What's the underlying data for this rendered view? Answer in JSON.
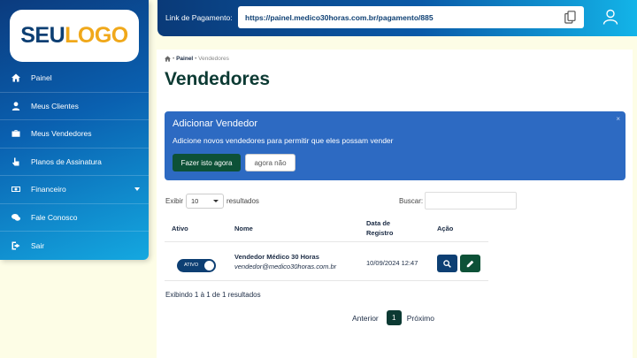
{
  "logo": {
    "part1": "SEU",
    "part2": "LOGO"
  },
  "topbar": {
    "payment_label": "Link de Pagamento:",
    "payment_url": "https://painel.medico30horas.com.br/pagamento/885"
  },
  "sidebar": {
    "items": [
      {
        "label": "Painel",
        "icon": "home-icon"
      },
      {
        "label": "Meus Clientes",
        "icon": "user-icon"
      },
      {
        "label": "Meus Vendedores",
        "icon": "briefcase-icon"
      },
      {
        "label": "Planos de Assinatura",
        "icon": "hand-pointer-icon"
      },
      {
        "label": "Financeiro",
        "icon": "money-icon"
      },
      {
        "label": "Fale Conosco",
        "icon": "chat-icon"
      },
      {
        "label": "Sair",
        "icon": "sign-out-icon"
      }
    ]
  },
  "breadcrumb": {
    "home": "Painel",
    "current": "Vendedores",
    "separator": "•"
  },
  "page": {
    "title": "Vendedores"
  },
  "alert": {
    "title": "Adicionar Vendedor",
    "close": "×",
    "text": "Adicione novos vendedores para permitir que eles possam vender",
    "primary_button": "Fazer isto agora",
    "secondary_button": "agora não"
  },
  "table_controls": {
    "show_label": "Exibir",
    "show_value": "10",
    "results_label": "resultados",
    "search_label": "Buscar:"
  },
  "table": {
    "headers": {
      "status": "Ativo",
      "name": "Nome",
      "date_line1": "Data de",
      "date_line2": "Registro",
      "action": "Ação"
    },
    "rows": [
      {
        "status_label": "ATIVO",
        "name": "Vendedor Médico 30 Horas",
        "email": "vendedor@medico30horas.com.br",
        "date": "10/09/2024 12:47"
      }
    ]
  },
  "table_info": "Exibindo 1 à 1 de 1 resultados",
  "pagination": {
    "prev": "Anterior",
    "current": "1",
    "next": "Próximo"
  },
  "colors": {
    "primary_dark": "#0d3f73",
    "green": "#0d5137",
    "alert_blue": "#2d6ac2",
    "accent_orange": "#f0a81a"
  }
}
